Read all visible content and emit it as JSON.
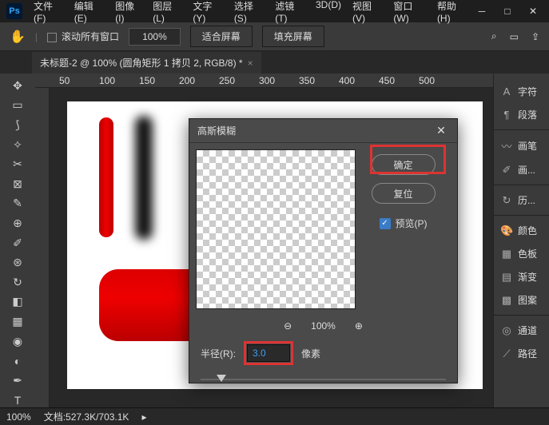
{
  "app": {
    "logo": "Ps"
  },
  "menu": {
    "file": "文件(F)",
    "edit": "编辑(E)",
    "image": "图像(I)",
    "layer": "图层(L)",
    "type": "文字(Y)",
    "select": "选择(S)",
    "filter": "滤镜(T)",
    "threeD": "3D(D)",
    "view": "视图(V)",
    "window": "窗口(W)",
    "help": "帮助(H)"
  },
  "toolbar": {
    "scroll_all": "滚动所有窗口",
    "zoom": "100%",
    "fit_screen": "适合屏幕",
    "fill_screen": "填充屏幕"
  },
  "tab": {
    "title": "未标题-2 @ 100% (圆角矩形 1 拷贝 2, RGB/8) *"
  },
  "ruler": {
    "m50": "50",
    "m100": "100",
    "m150": "150",
    "m200": "200",
    "m250": "250",
    "m300": "300",
    "m350": "350",
    "m400": "400",
    "m450": "450",
    "m500": "500"
  },
  "panels": {
    "character": "字符",
    "paragraph": "段落",
    "brush": "画笔",
    "brush_preset": "画...",
    "history": "历...",
    "color": "颜色",
    "swatch": "色板",
    "gradient": "渐变",
    "pattern": "图案",
    "channel": "通道",
    "path": "路径"
  },
  "dialog": {
    "title": "高斯模糊",
    "ok": "确定",
    "reset": "复位",
    "preview": "预览(P)",
    "zoom": "100%",
    "radius_label": "半径(R):",
    "radius_value": "3.0",
    "unit": "像素"
  },
  "status": {
    "zoom": "100%",
    "doc": "文档:527.3K/703.1K"
  }
}
